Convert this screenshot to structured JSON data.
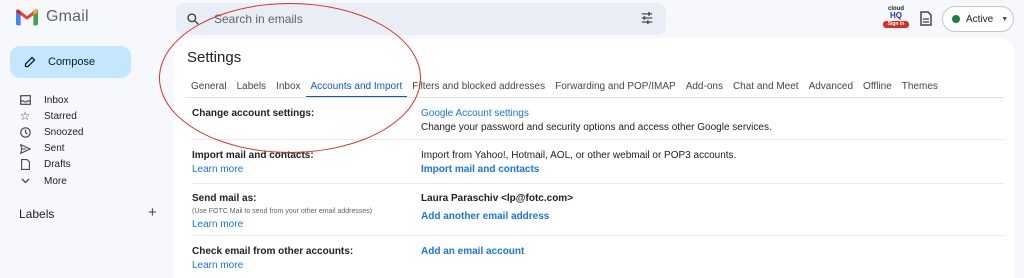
{
  "app": {
    "name": "Gmail"
  },
  "search": {
    "placeholder": "Search in emails"
  },
  "badge": {
    "line1": "cloud",
    "line2": "HQ",
    "line3": "Sign in"
  },
  "status": {
    "label": "Active"
  },
  "sidebar": {
    "compose": "Compose",
    "items": [
      {
        "label": "Inbox",
        "icon": "inbox-icon"
      },
      {
        "label": "Starred",
        "icon": "star-icon"
      },
      {
        "label": "Snoozed",
        "icon": "clock-icon"
      },
      {
        "label": "Sent",
        "icon": "send-icon"
      },
      {
        "label": "Drafts",
        "icon": "draft-icon"
      },
      {
        "label": "More",
        "icon": "chevron-down-icon"
      }
    ],
    "labels_heading": "Labels"
  },
  "settings": {
    "title": "Settings",
    "tabs": [
      "General",
      "Labels",
      "Inbox",
      "Accounts and Import",
      "Filters and blocked addresses",
      "Forwarding and POP/IMAP",
      "Add-ons",
      "Chat and Meet",
      "Advanced",
      "Offline",
      "Themes"
    ],
    "active_tab": "Accounts and Import",
    "rows": {
      "change_account": {
        "label": "Change account settings:",
        "link": "Google Account settings",
        "desc": "Change your password and security options and access other Google services."
      },
      "import": {
        "label": "Import mail and contacts:",
        "learn_more": "Learn more",
        "desc": "Import from Yahoo!, Hotmail, AOL, or other webmail or POP3 accounts.",
        "action": "Import mail and contacts"
      },
      "send_as": {
        "label": "Send mail as:",
        "sub": "(Use FOTC Mail to send from your other email addresses)",
        "learn_more": "Learn more",
        "identity": "Laura Paraschiv <lp@fotc.com>",
        "action": "Add another email address"
      },
      "check_other": {
        "label": "Check email from other accounts:",
        "learn_more": "Learn more",
        "action": "Add an email account"
      }
    }
  },
  "colors": {
    "accent": "#0b57d0",
    "compose_bg": "#c2e7ff",
    "annotation": "#d93025",
    "active_dot": "#188038"
  }
}
